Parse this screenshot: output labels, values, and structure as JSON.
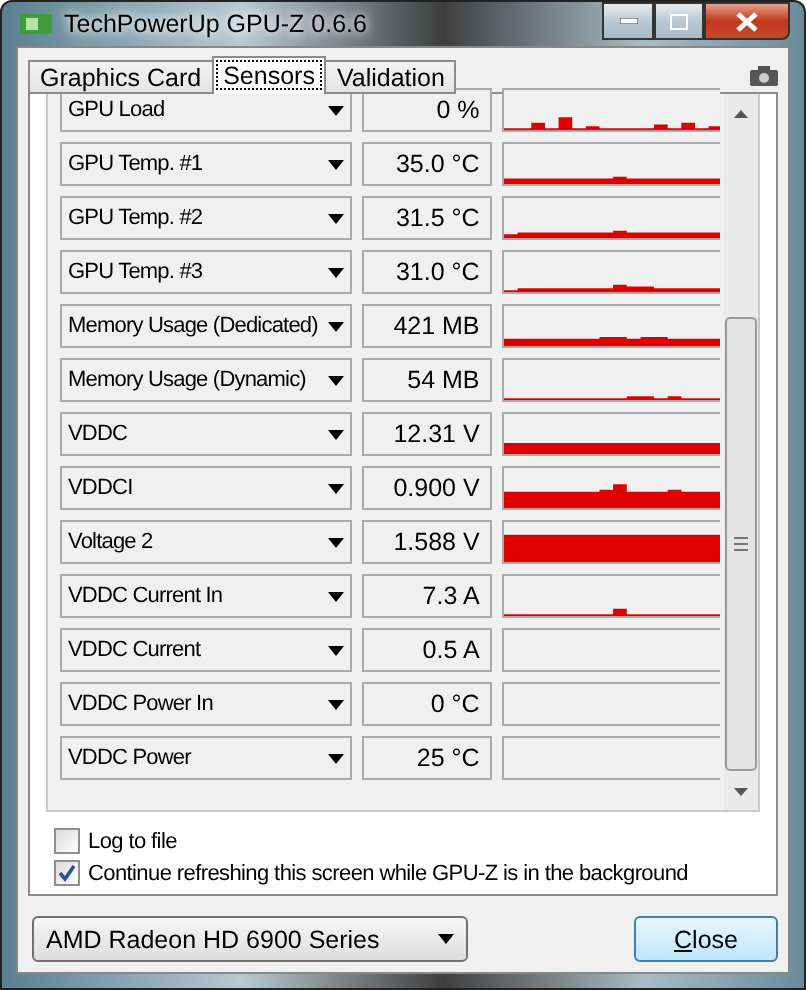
{
  "window": {
    "title": "TechPowerUp GPU-Z 0.6.6"
  },
  "tabs": [
    {
      "label": "Graphics Card",
      "selected": false
    },
    {
      "label": "Sensors",
      "selected": true
    },
    {
      "label": "Validation",
      "selected": false
    }
  ],
  "sensors": [
    {
      "name": "GPU Load",
      "value": "0 %"
    },
    {
      "name": "GPU Temp. #1",
      "value": "35.0 °C"
    },
    {
      "name": "GPU Temp. #2",
      "value": "31.5 °C"
    },
    {
      "name": "GPU Temp. #3",
      "value": "31.0 °C"
    },
    {
      "name": "Memory Usage (Dedicated)",
      "value": "421 MB"
    },
    {
      "name": "Memory Usage (Dynamic)",
      "value": "54 MB"
    },
    {
      "name": "VDDC",
      "value": "12.31 V"
    },
    {
      "name": "VDDCI",
      "value": "0.900 V"
    },
    {
      "name": "Voltage 2",
      "value": "1.588 V"
    },
    {
      "name": "VDDC Current In",
      "value": "7.3 A"
    },
    {
      "name": "VDDC Current",
      "value": "0.5 A"
    },
    {
      "name": "VDDC Power In",
      "value": "0 °C"
    },
    {
      "name": "VDDC Power",
      "value": "25 °C"
    }
  ],
  "options": [
    {
      "label": "Log to file",
      "checked": false
    },
    {
      "label": "Continue refreshing this screen while GPU-Z is in the background",
      "checked": true
    }
  ],
  "device": {
    "value": "AMD Radeon HD 6900 Series"
  },
  "close_button": "Close"
}
